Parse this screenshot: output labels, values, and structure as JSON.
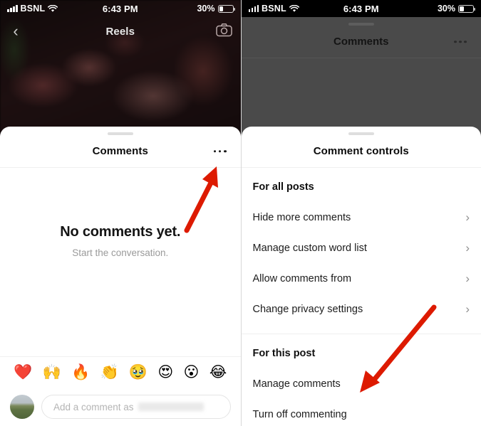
{
  "colors": {
    "accent_red": "#dd1a00",
    "dim_overlay": "#4a4a4a",
    "sheet_bg": "#ffffff"
  },
  "status_bar": {
    "carrier": "BSNL",
    "time": "6:43 PM",
    "battery_percent": "30%"
  },
  "left_panel": {
    "reels_header": {
      "title": "Reels",
      "back_icon": "chevron-left-icon",
      "camera_icon": "camera-icon"
    },
    "comments_sheet": {
      "title": "Comments",
      "more_icon": "more-options-icon",
      "empty_title": "No comments yet.",
      "empty_subtitle": "Start the conversation.",
      "quick_emojis": [
        "❤️",
        "🙌",
        "🔥",
        "👏",
        "🥹",
        "😍",
        "😮",
        "😂"
      ],
      "composer_placeholder": "Add a comment as"
    }
  },
  "right_panel": {
    "background_sheet": {
      "title": "Comments",
      "more_icon": "more-options-icon"
    },
    "controls_sheet": {
      "title": "Comment controls",
      "sections": [
        {
          "heading": "For all posts",
          "items": [
            {
              "label": "Hide more comments",
              "chevron": "›"
            },
            {
              "label": "Manage custom word list",
              "chevron": "›"
            },
            {
              "label": "Allow comments from",
              "chevron": "›"
            },
            {
              "label": "Change privacy settings",
              "chevron": "›"
            }
          ]
        },
        {
          "heading": "For this post",
          "items": [
            {
              "label": "Manage comments",
              "chevron": ""
            },
            {
              "label": "Turn off commenting",
              "chevron": ""
            }
          ]
        }
      ]
    }
  }
}
